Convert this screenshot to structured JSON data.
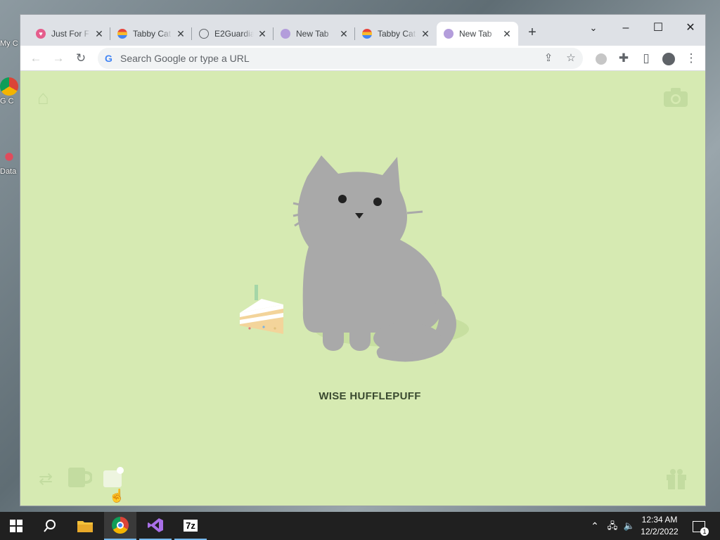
{
  "desktop": {
    "icons": [
      {
        "label": "My C"
      },
      {
        "label": "G C"
      },
      {
        "label": "Data"
      }
    ]
  },
  "browser": {
    "tabs": [
      {
        "title": "Just For F",
        "favicon": "heart-icon",
        "active": false
      },
      {
        "title": "Tabby Cat",
        "favicon": "rainbow-icon",
        "active": false
      },
      {
        "title": "E2Guardia",
        "favicon": "globe-icon",
        "active": false
      },
      {
        "title": "New Tab",
        "favicon": "cat-face-icon",
        "active": false
      },
      {
        "title": "Tabby Cat",
        "favicon": "rainbow-icon",
        "active": false
      },
      {
        "title": "New Tab",
        "favicon": "cat-face-icon",
        "active": true
      }
    ],
    "omnibox": {
      "placeholder": "Search Google or type a URL",
      "value": ""
    }
  },
  "page": {
    "cat_name": "WISE HUFFLEPUFF",
    "colors": {
      "background": "#d6eab2",
      "cat": "#a9a9a9",
      "faded_icon": "#c3dca0"
    }
  },
  "taskbar": {
    "apps": [
      "windows-start-icon",
      "search-icon",
      "file-explorer-icon",
      "chrome-icon",
      "visual-studio-icon",
      "7zip-icon"
    ],
    "sevenzip_label": "7z",
    "time": "12:34 AM",
    "date": "12/2/2022",
    "notification_count": "1"
  }
}
